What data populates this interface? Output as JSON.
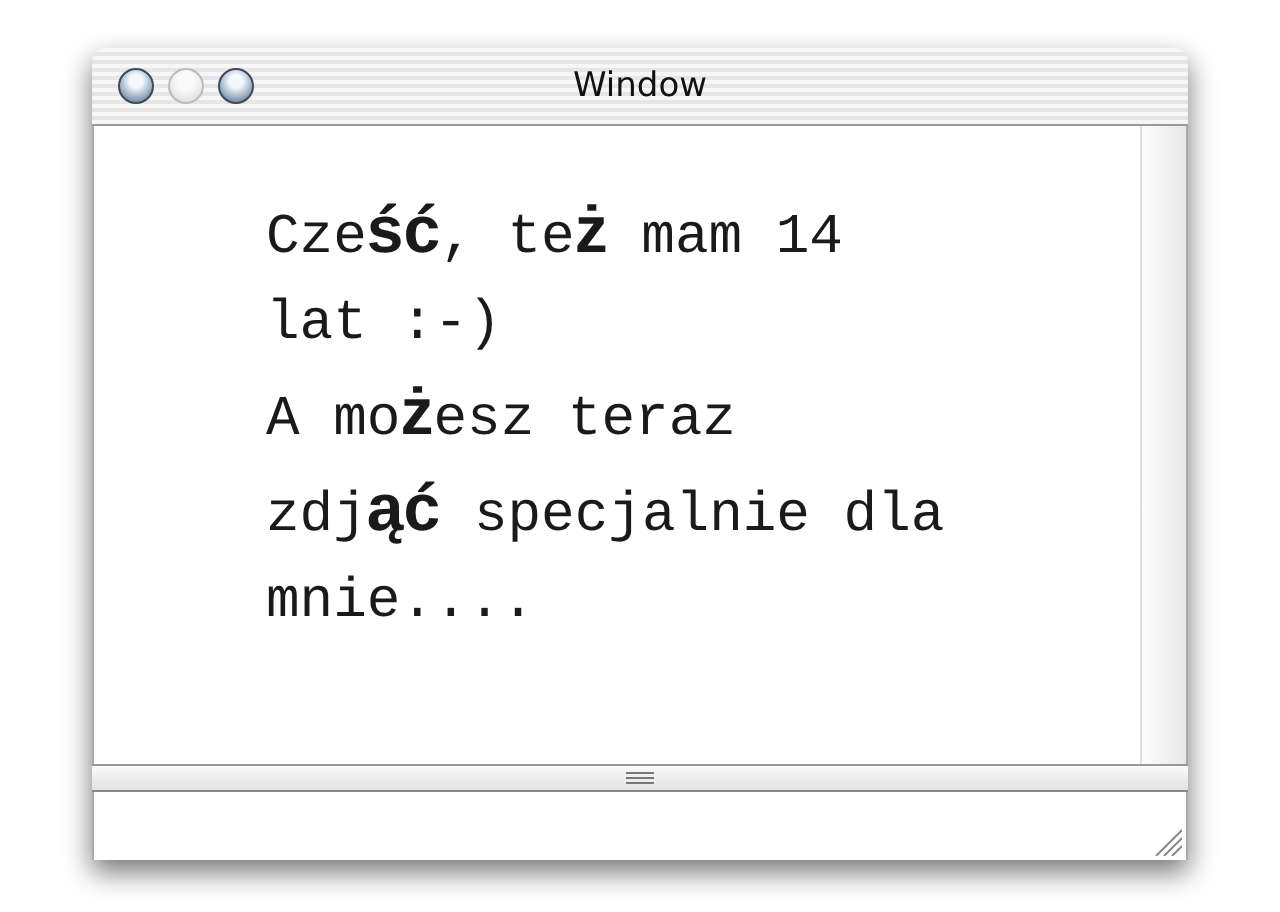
{
  "window": {
    "title": "Window",
    "buttons": [
      {
        "disabled": false
      },
      {
        "disabled": true
      },
      {
        "disabled": false
      }
    ]
  },
  "text_view": {
    "lines": [
      "Cze**ść**, te**ż** mam 14",
      "lat :-)",
      "A mo**ż**esz teraz",
      "zdj**ąć** specjalnie dla",
      "mnie...."
    ]
  }
}
